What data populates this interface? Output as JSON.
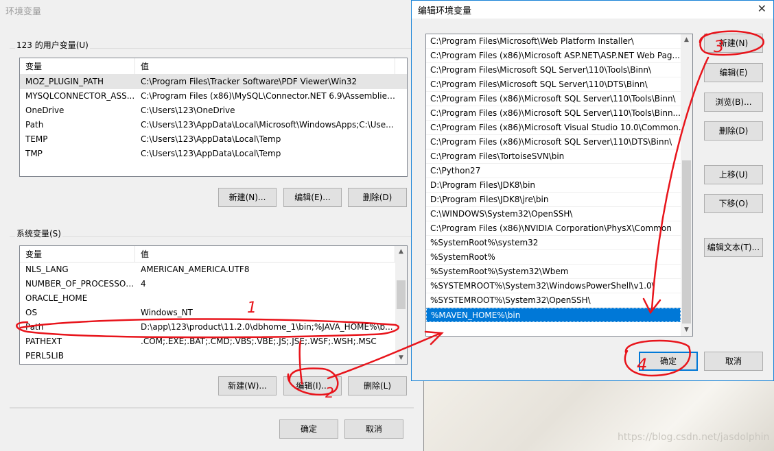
{
  "env_dialog": {
    "title": "环境变量",
    "user_vars": {
      "label": "123 的用户变量(U)",
      "headers": [
        "变量",
        "值"
      ],
      "rows": [
        {
          "name": "MOZ_PLUGIN_PATH",
          "value": "C:\\Program Files\\Tracker Software\\PDF Viewer\\Win32"
        },
        {
          "name": "MYSQLCONNECTOR_ASS...",
          "value": "C:\\Program Files (x86)\\MySQL\\Connector.NET 6.9\\Assemblies..."
        },
        {
          "name": "OneDrive",
          "value": "C:\\Users\\123\\OneDrive"
        },
        {
          "name": "Path",
          "value": "C:\\Users\\123\\AppData\\Local\\Microsoft\\WindowsApps;C:\\Use..."
        },
        {
          "name": "TEMP",
          "value": "C:\\Users\\123\\AppData\\Local\\Temp"
        },
        {
          "name": "TMP",
          "value": "C:\\Users\\123\\AppData\\Local\\Temp"
        }
      ],
      "buttons": {
        "new": "新建(N)...",
        "edit": "编辑(E)...",
        "delete": "删除(D)"
      }
    },
    "system_vars": {
      "label": "系统变量(S)",
      "headers": [
        "变量",
        "值"
      ],
      "rows": [
        {
          "name": "NLS_LANG",
          "value": "AMERICAN_AMERICA.UTF8"
        },
        {
          "name": "NUMBER_OF_PROCESSORS",
          "value": "4"
        },
        {
          "name": "ORACLE_HOME",
          "value": ""
        },
        {
          "name": "OS",
          "value": "Windows_NT"
        },
        {
          "name": "Path",
          "value": "D:\\app\\123\\product\\11.2.0\\dbhome_1\\bin;%JAVA_HOME%\\b..."
        },
        {
          "name": "PATHEXT",
          "value": ".COM;.EXE;.BAT;.CMD;.VBS;.VBE;.JS;.JSE;.WSF;.WSH;.MSC"
        },
        {
          "name": "PERL5LIB",
          "value": ""
        }
      ],
      "buttons": {
        "new": "新建(W)...",
        "edit": "编辑(I)...",
        "delete": "删除(L)"
      }
    },
    "ok": "确定",
    "cancel": "取消"
  },
  "edit_dialog": {
    "title": "编辑环境变量",
    "close_glyph": "✕",
    "paths": [
      "C:\\Program Files\\Microsoft\\Web Platform Installer\\",
      "C:\\Program Files (x86)\\Microsoft ASP.NET\\ASP.NET Web Pag...",
      "C:\\Program Files\\Microsoft SQL Server\\110\\Tools\\Binn\\",
      "C:\\Program Files\\Microsoft SQL Server\\110\\DTS\\Binn\\",
      "C:\\Program Files (x86)\\Microsoft SQL Server\\110\\Tools\\Binn\\",
      "C:\\Program Files (x86)\\Microsoft SQL Server\\110\\Tools\\Binn...",
      "C:\\Program Files (x86)\\Microsoft Visual Studio 10.0\\Common...",
      "C:\\Program Files (x86)\\Microsoft SQL Server\\110\\DTS\\Binn\\",
      "C:\\Program Files\\TortoiseSVN\\bin",
      "C:\\Python27",
      "D:\\Program Files\\JDK8\\bin",
      "D:\\Program Files\\JDK8\\jre\\bin",
      "C:\\WINDOWS\\System32\\OpenSSH\\",
      "C:\\Program Files (x86)\\NVIDIA Corporation\\PhysX\\Common",
      "%SystemRoot%\\system32",
      "%SystemRoot%",
      "%SystemRoot%\\System32\\Wbem",
      "%SYSTEMROOT%\\System32\\WindowsPowerShell\\v1.0\\",
      "%SYSTEMROOT%\\System32\\OpenSSH\\",
      "%MAVEN_HOME%\\bin"
    ],
    "selected_index": 19,
    "buttons": {
      "new": "新建(N)",
      "edit": "编辑(E)",
      "browse": "浏览(B)...",
      "delete": "删除(D)",
      "up": "上移(U)",
      "down": "下移(O)",
      "edit_text": "编辑文本(T)..."
    },
    "ok": "确定",
    "cancel": "取消"
  },
  "annotations": {
    "step1": "1",
    "step2": "2",
    "step3": "3",
    "step4": "4"
  },
  "watermark": "https://blog.csdn.net/jasdolphin"
}
